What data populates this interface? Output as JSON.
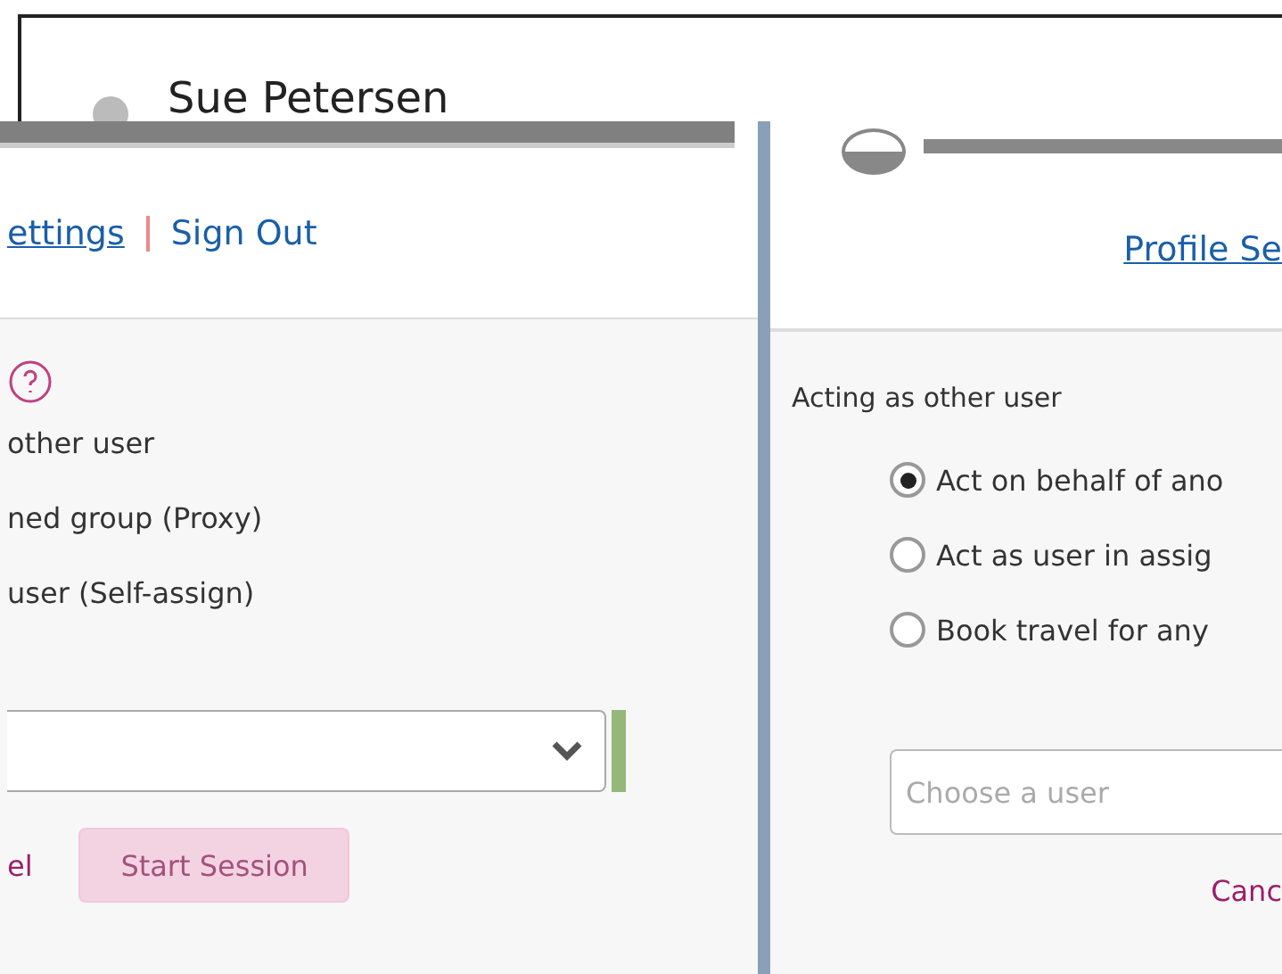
{
  "header": {
    "user_name": "Sue Petersen"
  },
  "left_panel": {
    "links": [
      {
        "label": "ettings",
        "kind": "link"
      },
      {
        "label": "Sign Out",
        "kind": "plain"
      }
    ],
    "options": [
      "other user",
      "ned group (Proxy)",
      "user (Self-assign)"
    ],
    "cancel": "el",
    "start_button": {
      "label": "Start Session",
      "disabled": true
    }
  },
  "right_panel": {
    "link": "Profile Se",
    "title": "Acting as other user",
    "options": [
      {
        "label": "Act on behalf of ano",
        "selected": true
      },
      {
        "label": "Act as user in assig",
        "selected": false
      },
      {
        "label": "Book travel for any",
        "selected": false
      }
    ],
    "user_field": {
      "placeholder": "Choose a user"
    },
    "cancel": "Canc"
  }
}
